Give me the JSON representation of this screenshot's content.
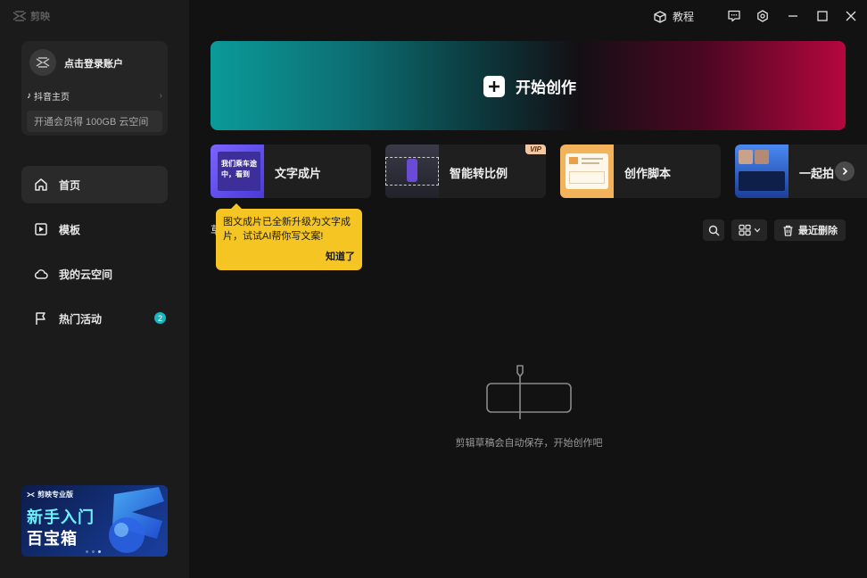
{
  "app": {
    "name": "剪映"
  },
  "account": {
    "login_label": "点击登录账户",
    "douyin_label": "抖音主页",
    "vip_label": "开通会员得 100GB 云空间"
  },
  "nav": {
    "items": [
      {
        "label": "首页",
        "icon": "home-icon",
        "active": true
      },
      {
        "label": "模板",
        "icon": "template-icon"
      },
      {
        "label": "我的云空间",
        "icon": "cloud-icon"
      },
      {
        "label": "热门活动",
        "icon": "flag-icon",
        "badge": "2"
      }
    ]
  },
  "promo": {
    "brand": "剪映专业版",
    "line1": "新手入门",
    "line2": "百宝箱"
  },
  "titlebar": {
    "tutorial_label": "教程",
    "icons": [
      "cube-icon",
      "feedback-icon",
      "settings-icon",
      "minimize-icon",
      "maximize-icon",
      "close-icon"
    ]
  },
  "hero": {
    "label": "开始创作"
  },
  "cards": [
    {
      "label": "文字成片",
      "thumb_text": "我们乘车途中，看到"
    },
    {
      "label": "智能转比例",
      "vip": "VIP"
    },
    {
      "label": "创作脚本"
    },
    {
      "label": "一起拍"
    }
  ],
  "tooltip": {
    "text": "图文成片已全新升级为文字成片，试试AI帮你写文案!",
    "button": "知道了"
  },
  "drafts": {
    "title": "草稿",
    "recent_delete": "最近删除",
    "empty_text": "剪辑草稿会自动保存，开始创作吧"
  },
  "colors": {
    "accent": "#17b6c0",
    "tooltip": "#f5c623",
    "sidebar_bg": "#1b1b1b",
    "main_bg": "#121212"
  }
}
